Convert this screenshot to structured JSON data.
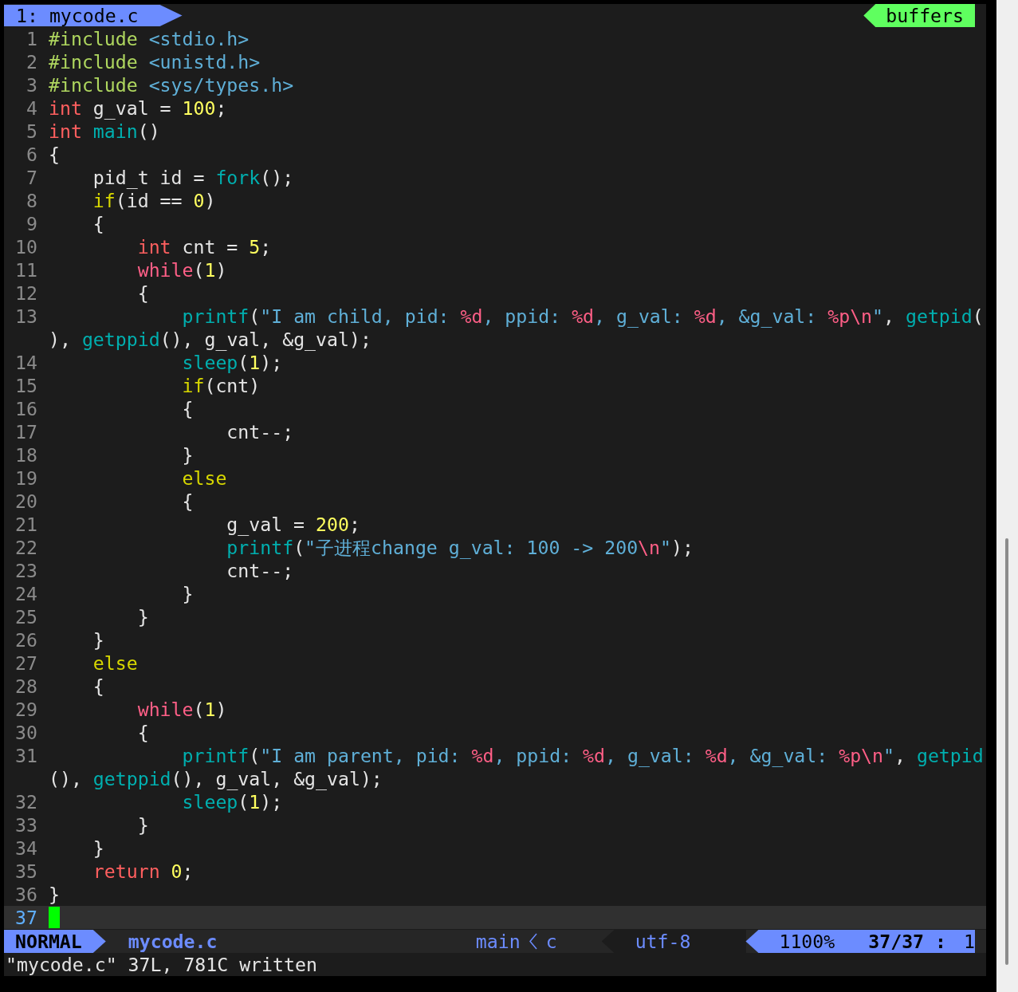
{
  "tabline": {
    "tabs": [
      {
        "label": "1: mycode.c",
        "selected": true
      }
    ],
    "buffers_label": "buffers"
  },
  "lines": [
    {
      "number": "1",
      "current": false,
      "cursor": false,
      "rows": [
        {
          "segments": [
            {
              "kind": "preproc",
              "text": "#include "
            },
            {
              "kind": "include",
              "text": "<stdio.h>"
            }
          ]
        }
      ]
    },
    {
      "number": "2",
      "current": false,
      "cursor": false,
      "rows": [
        {
          "segments": [
            {
              "kind": "preproc",
              "text": "#include "
            },
            {
              "kind": "include",
              "text": "<unistd.h>"
            }
          ]
        }
      ]
    },
    {
      "number": "3",
      "current": false,
      "cursor": false,
      "rows": [
        {
          "segments": [
            {
              "kind": "preproc",
              "text": "#include "
            },
            {
              "kind": "include",
              "text": "<sys/types.h>"
            }
          ]
        }
      ]
    },
    {
      "number": "4",
      "current": false,
      "cursor": false,
      "rows": [
        {
          "segments": [
            {
              "kind": "type",
              "text": "int"
            },
            {
              "kind": "plain",
              "text": " g_val = "
            },
            {
              "kind": "number",
              "text": "100"
            },
            {
              "kind": "plain",
              "text": ";"
            }
          ]
        }
      ]
    },
    {
      "number": "5",
      "current": false,
      "cursor": false,
      "rows": [
        {
          "segments": [
            {
              "kind": "type",
              "text": "int "
            },
            {
              "kind": "function",
              "text": "main"
            },
            {
              "kind": "plain",
              "text": "()"
            }
          ]
        }
      ]
    },
    {
      "number": "6",
      "current": false,
      "cursor": false,
      "rows": [
        {
          "segments": [
            {
              "kind": "plain",
              "text": "{"
            }
          ]
        }
      ]
    },
    {
      "number": "7",
      "current": false,
      "cursor": false,
      "rows": [
        {
          "segments": [
            {
              "kind": "plain",
              "text": "    pid_t id = "
            },
            {
              "kind": "function",
              "text": "fork"
            },
            {
              "kind": "plain",
              "text": "();"
            }
          ]
        }
      ]
    },
    {
      "number": "8",
      "current": false,
      "cursor": false,
      "rows": [
        {
          "segments": [
            {
              "kind": "conditional",
              "text": "    if"
            },
            {
              "kind": "plain",
              "text": "(id == "
            },
            {
              "kind": "number",
              "text": "0"
            },
            {
              "kind": "plain",
              "text": ")"
            }
          ]
        }
      ]
    },
    {
      "number": "9",
      "current": false,
      "cursor": false,
      "rows": [
        {
          "segments": [
            {
              "kind": "plain",
              "text": "    {"
            }
          ]
        }
      ]
    },
    {
      "number": "10",
      "current": false,
      "cursor": false,
      "rows": [
        {
          "segments": [
            {
              "kind": "type",
              "text": "        int"
            },
            {
              "kind": "plain",
              "text": " cnt = "
            },
            {
              "kind": "number",
              "text": "5"
            },
            {
              "kind": "plain",
              "text": ";"
            }
          ]
        }
      ]
    },
    {
      "number": "11",
      "current": false,
      "cursor": false,
      "rows": [
        {
          "segments": [
            {
              "kind": "loop",
              "text": "        while"
            },
            {
              "kind": "plain",
              "text": "("
            },
            {
              "kind": "number",
              "text": "1"
            },
            {
              "kind": "plain",
              "text": ")"
            }
          ]
        }
      ]
    },
    {
      "number": "12",
      "current": false,
      "cursor": false,
      "rows": [
        {
          "segments": [
            {
              "kind": "plain",
              "text": "        {"
            }
          ]
        }
      ]
    },
    {
      "number": "13",
      "current": false,
      "cursor": false,
      "rows": [
        {
          "segments": [
            {
              "kind": "function",
              "text": "            printf"
            },
            {
              "kind": "plain",
              "text": "("
            },
            {
              "kind": "string",
              "text": "\"I am child, pid: "
            },
            {
              "kind": "format",
              "text": "%d"
            },
            {
              "kind": "string",
              "text": ", ppid: "
            },
            {
              "kind": "format",
              "text": "%d"
            },
            {
              "kind": "string",
              "text": ", g_val: "
            },
            {
              "kind": "format",
              "text": "%d"
            },
            {
              "kind": "string",
              "text": ", &g_val: "
            },
            {
              "kind": "format",
              "text": "%p\\n"
            },
            {
              "kind": "string",
              "text": "\""
            },
            {
              "kind": "plain",
              "text": ", "
            },
            {
              "kind": "function",
              "text": "getpid"
            },
            {
              "kind": "plain",
              "text": "("
            }
          ]
        },
        {
          "segments": [
            {
              "kind": "plain",
              "text": "), "
            },
            {
              "kind": "function",
              "text": "getppid"
            },
            {
              "kind": "plain",
              "text": "(), g_val, &g_val);"
            }
          ]
        }
      ]
    },
    {
      "number": "14",
      "current": false,
      "cursor": false,
      "rows": [
        {
          "segments": [
            {
              "kind": "function",
              "text": "            sleep"
            },
            {
              "kind": "plain",
              "text": "("
            },
            {
              "kind": "number",
              "text": "1"
            },
            {
              "kind": "plain",
              "text": ");"
            }
          ]
        }
      ]
    },
    {
      "number": "15",
      "current": false,
      "cursor": false,
      "rows": [
        {
          "segments": [
            {
              "kind": "conditional",
              "text": "            if"
            },
            {
              "kind": "plain",
              "text": "(cnt)"
            }
          ]
        }
      ]
    },
    {
      "number": "16",
      "current": false,
      "cursor": false,
      "rows": [
        {
          "segments": [
            {
              "kind": "plain",
              "text": "            {"
            }
          ]
        }
      ]
    },
    {
      "number": "17",
      "current": false,
      "cursor": false,
      "rows": [
        {
          "segments": [
            {
              "kind": "plain",
              "text": "                cnt--;"
            }
          ]
        }
      ]
    },
    {
      "number": "18",
      "current": false,
      "cursor": false,
      "rows": [
        {
          "segments": [
            {
              "kind": "plain",
              "text": "            }"
            }
          ]
        }
      ]
    },
    {
      "number": "19",
      "current": false,
      "cursor": false,
      "rows": [
        {
          "segments": [
            {
              "kind": "conditional",
              "text": "            else"
            }
          ]
        }
      ]
    },
    {
      "number": "20",
      "current": false,
      "cursor": false,
      "rows": [
        {
          "segments": [
            {
              "kind": "plain",
              "text": "            {"
            }
          ]
        }
      ]
    },
    {
      "number": "21",
      "current": false,
      "cursor": false,
      "rows": [
        {
          "segments": [
            {
              "kind": "plain",
              "text": "                g_val = "
            },
            {
              "kind": "number",
              "text": "200"
            },
            {
              "kind": "plain",
              "text": ";"
            }
          ]
        }
      ]
    },
    {
      "number": "22",
      "current": false,
      "cursor": false,
      "rows": [
        {
          "segments": [
            {
              "kind": "function",
              "text": "                printf"
            },
            {
              "kind": "plain",
              "text": "("
            },
            {
              "kind": "string",
              "text": "\"子进程change g_val: 100 -> 200"
            },
            {
              "kind": "format",
              "text": "\\n"
            },
            {
              "kind": "string",
              "text": "\""
            },
            {
              "kind": "plain",
              "text": ");"
            }
          ]
        }
      ]
    },
    {
      "number": "23",
      "current": false,
      "cursor": false,
      "rows": [
        {
          "segments": [
            {
              "kind": "plain",
              "text": "                cnt--;"
            }
          ]
        }
      ]
    },
    {
      "number": "24",
      "current": false,
      "cursor": false,
      "rows": [
        {
          "segments": [
            {
              "kind": "plain",
              "text": "            }"
            }
          ]
        }
      ]
    },
    {
      "number": "25",
      "current": false,
      "cursor": false,
      "rows": [
        {
          "segments": [
            {
              "kind": "plain",
              "text": "        }"
            }
          ]
        }
      ]
    },
    {
      "number": "26",
      "current": false,
      "cursor": false,
      "rows": [
        {
          "segments": [
            {
              "kind": "plain",
              "text": "    }"
            }
          ]
        }
      ]
    },
    {
      "number": "27",
      "current": false,
      "cursor": false,
      "rows": [
        {
          "segments": [
            {
              "kind": "conditional",
              "text": "    else"
            }
          ]
        }
      ]
    },
    {
      "number": "28",
      "current": false,
      "cursor": false,
      "rows": [
        {
          "segments": [
            {
              "kind": "plain",
              "text": "    {"
            }
          ]
        }
      ]
    },
    {
      "number": "29",
      "current": false,
      "cursor": false,
      "rows": [
        {
          "segments": [
            {
              "kind": "loop",
              "text": "        while"
            },
            {
              "kind": "plain",
              "text": "("
            },
            {
              "kind": "number",
              "text": "1"
            },
            {
              "kind": "plain",
              "text": ")"
            }
          ]
        }
      ]
    },
    {
      "number": "30",
      "current": false,
      "cursor": false,
      "rows": [
        {
          "segments": [
            {
              "kind": "plain",
              "text": "        {"
            }
          ]
        }
      ]
    },
    {
      "number": "31",
      "current": false,
      "cursor": false,
      "rows": [
        {
          "segments": [
            {
              "kind": "function",
              "text": "            printf"
            },
            {
              "kind": "plain",
              "text": "("
            },
            {
              "kind": "string",
              "text": "\"I am parent, pid: "
            },
            {
              "kind": "format",
              "text": "%d"
            },
            {
              "kind": "string",
              "text": ", ppid: "
            },
            {
              "kind": "format",
              "text": "%d"
            },
            {
              "kind": "string",
              "text": ", g_val: "
            },
            {
              "kind": "format",
              "text": "%d"
            },
            {
              "kind": "string",
              "text": ", &g_val: "
            },
            {
              "kind": "format",
              "text": "%p\\n"
            },
            {
              "kind": "string",
              "text": "\""
            },
            {
              "kind": "plain",
              "text": ", "
            },
            {
              "kind": "function",
              "text": "getpid"
            }
          ]
        },
        {
          "segments": [
            {
              "kind": "plain",
              "text": "(), "
            },
            {
              "kind": "function",
              "text": "getppid"
            },
            {
              "kind": "plain",
              "text": "(), g_val, &g_val);"
            }
          ]
        }
      ]
    },
    {
      "number": "32",
      "current": false,
      "cursor": false,
      "rows": [
        {
          "segments": [
            {
              "kind": "function",
              "text": "            sleep"
            },
            {
              "kind": "plain",
              "text": "("
            },
            {
              "kind": "number",
              "text": "1"
            },
            {
              "kind": "plain",
              "text": ");"
            }
          ]
        }
      ]
    },
    {
      "number": "33",
      "current": false,
      "cursor": false,
      "rows": [
        {
          "segments": [
            {
              "kind": "plain",
              "text": "        }"
            }
          ]
        }
      ]
    },
    {
      "number": "34",
      "current": false,
      "cursor": false,
      "rows": [
        {
          "segments": [
            {
              "kind": "plain",
              "text": "    }"
            }
          ]
        }
      ]
    },
    {
      "number": "35",
      "current": false,
      "cursor": false,
      "rows": [
        {
          "segments": [
            {
              "kind": "return",
              "text": "    return "
            },
            {
              "kind": "number",
              "text": "0"
            },
            {
              "kind": "plain",
              "text": ";"
            }
          ]
        }
      ]
    },
    {
      "number": "36",
      "current": false,
      "cursor": false,
      "rows": [
        {
          "segments": [
            {
              "kind": "plain",
              "text": "}"
            }
          ]
        }
      ]
    },
    {
      "number": "37",
      "current": true,
      "cursor": true
    }
  ],
  "status_bar": {
    "mode": "NORMAL",
    "filename": "mycode.c",
    "function": "main",
    "filetype": "c",
    "encoding": "utf-8",
    "percent": "1100%",
    "position": "37/37",
    "column_separator": ":",
    "column": "1"
  },
  "command_line": "\"mycode.c\" 37L, 781C written"
}
